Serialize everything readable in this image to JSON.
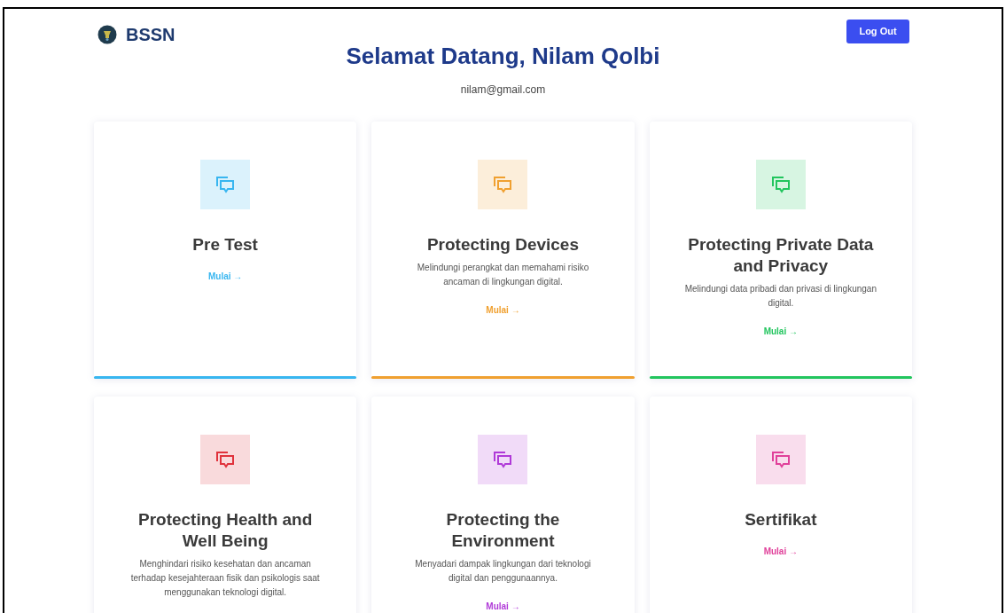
{
  "header": {
    "brand": "BSSN",
    "logout_button": "Log Out"
  },
  "greeting": "Selamat Datang, Nilam Qolbi",
  "email": "nilam@gmail.com",
  "cards": [
    {
      "title": "Pre Test",
      "link": "Mulai →",
      "color": "#38b6f0"
    },
    {
      "title": "Protecting Devices",
      "description": "Melindungi perangkat dan memahami risiko ancaman di lingkungan digital.",
      "link": "Mulai →",
      "color": "#f0a030"
    },
    {
      "title": "Protecting Private Data and Privacy",
      "description": "Melindungi data pribadi dan privasi di lingkungan digital.",
      "link": "Mulai →",
      "color": "#22c55e"
    },
    {
      "title": "Protecting Health and Well Being",
      "description": "Menghindari risiko kesehatan dan ancaman terhadap kesejahteraan fisik dan psikologis saat menggunakan teknologi digital.",
      "color": "#e0323c"
    },
    {
      "title": "Protecting the Environment",
      "description": "Menyadari dampak lingkungan dari teknologi digital dan penggunaannya.",
      "link": "Mulai →",
      "color": "#b03ad8"
    },
    {
      "title": "Sertifikat",
      "link": "Mulai →",
      "color": "#e0409a"
    }
  ]
}
